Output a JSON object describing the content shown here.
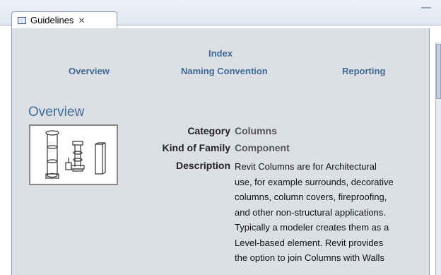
{
  "tab": {
    "title": "Guidelines",
    "close_glyph": "✕",
    "icon": "panel-icon"
  },
  "index": {
    "title": "Index",
    "links": {
      "overview": "Overview",
      "naming": "Naming Convention",
      "reporting": "Reporting"
    }
  },
  "section": {
    "title": "Overview"
  },
  "fields": {
    "category_label": "Category",
    "category_value": "Columns",
    "kind_label": "Kind of Family",
    "kind_value": "Component",
    "description_label": "Description",
    "description_value": "Revit Columns are for Architectural\nuse, for example surrounds, decorative\ncolumns, column covers, fireproofing,\nand other non-structural applications.\nTypically a modeler creates them as a\nLevel-based element. Revit provides\nthe option to join Columns with Walls"
  },
  "colors": {
    "link": "#3f6a96",
    "panel_bg": "#dcdfe4",
    "tab_border": "#8c9bb0"
  }
}
